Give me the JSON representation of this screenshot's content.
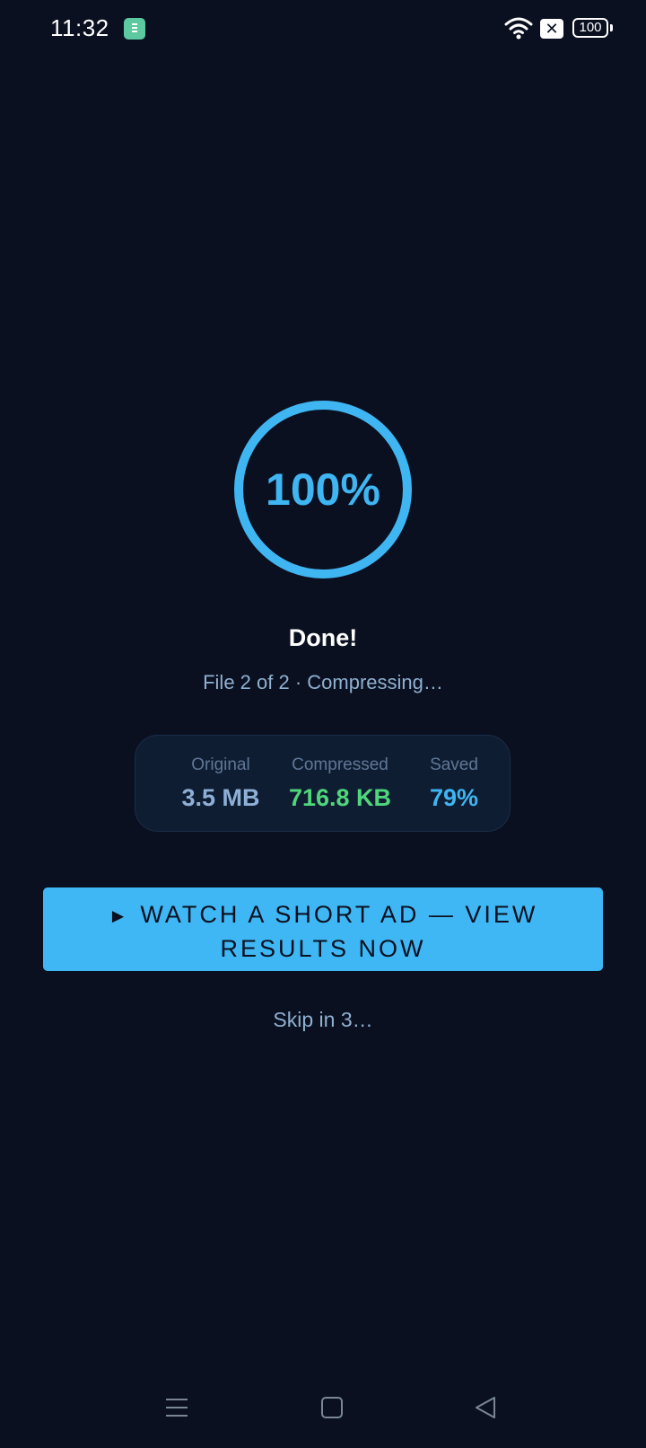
{
  "status_bar": {
    "time": "11:32",
    "battery": "100",
    "icons": [
      "app-notification-icon",
      "wifi-icon",
      "sim-x-icon",
      "battery-icon"
    ]
  },
  "progress": {
    "percent_label": "100%",
    "percent_value": 100,
    "ring_color": "#3fb5f2"
  },
  "status": {
    "title": "Done!",
    "subtitle": "File 2 of 2 · Compressing…"
  },
  "stats": {
    "original": {
      "label": "Original",
      "value": "3.5 MB",
      "color": "#8fb0d6"
    },
    "compressed": {
      "label": "Compressed",
      "value": "716.8 KB",
      "color": "#4fd67a"
    },
    "saved": {
      "label": "Saved",
      "value": "79%",
      "color": "#3fb5f2"
    }
  },
  "cta": {
    "play_icon": "►",
    "label": "WATCH A SHORT AD — VIEW RESULTS NOW",
    "color": "#3fb7f4"
  },
  "skip": {
    "label": "Skip in 3…"
  },
  "nav_bar": {
    "icons": [
      "menu-icon",
      "home-icon",
      "back-icon"
    ]
  },
  "colors": {
    "background": "#0a1020",
    "card": "#0f1d33",
    "muted_text": "#8fb0d0"
  }
}
